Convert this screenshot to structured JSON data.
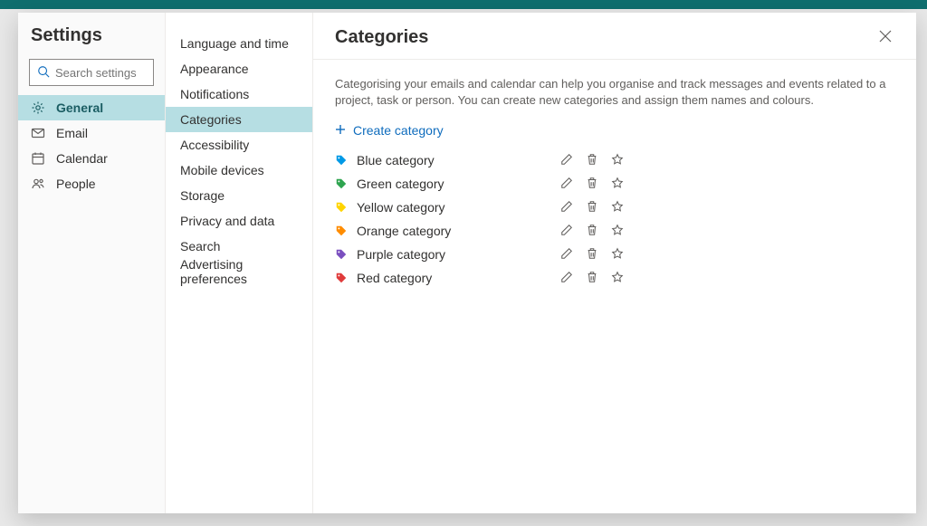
{
  "settings": {
    "title": "Settings",
    "searchPlaceholder": "Search settings",
    "nav": [
      {
        "icon": "gear",
        "label": "General",
        "active": true
      },
      {
        "icon": "mail",
        "label": "Email",
        "active": false
      },
      {
        "icon": "calendar",
        "label": "Calendar",
        "active": false
      },
      {
        "icon": "people",
        "label": "People",
        "active": false
      }
    ]
  },
  "subnav": [
    {
      "label": "Language and time",
      "active": false
    },
    {
      "label": "Appearance",
      "active": false
    },
    {
      "label": "Notifications",
      "active": false
    },
    {
      "label": "Categories",
      "active": true
    },
    {
      "label": "Accessibility",
      "active": false
    },
    {
      "label": "Mobile devices",
      "active": false
    },
    {
      "label": "Storage",
      "active": false
    },
    {
      "label": "Privacy and data",
      "active": false
    },
    {
      "label": "Search",
      "active": false
    },
    {
      "label": "Advertising preferences",
      "active": false
    }
  ],
  "panel": {
    "title": "Categories",
    "description": "Categorising your emails and calendar can help you organise and track messages and events related to a project, task or person. You can create new categories and assign them names and colours.",
    "createLabel": "Create category",
    "categories": [
      {
        "label": "Blue category",
        "color": "#0099e6"
      },
      {
        "label": "Green category",
        "color": "#2ea44f"
      },
      {
        "label": "Yellow category",
        "color": "#ffd400"
      },
      {
        "label": "Orange category",
        "color": "#ff8c00"
      },
      {
        "label": "Purple category",
        "color": "#7a4fbf"
      },
      {
        "label": "Red category",
        "color": "#e03b3b"
      }
    ]
  }
}
